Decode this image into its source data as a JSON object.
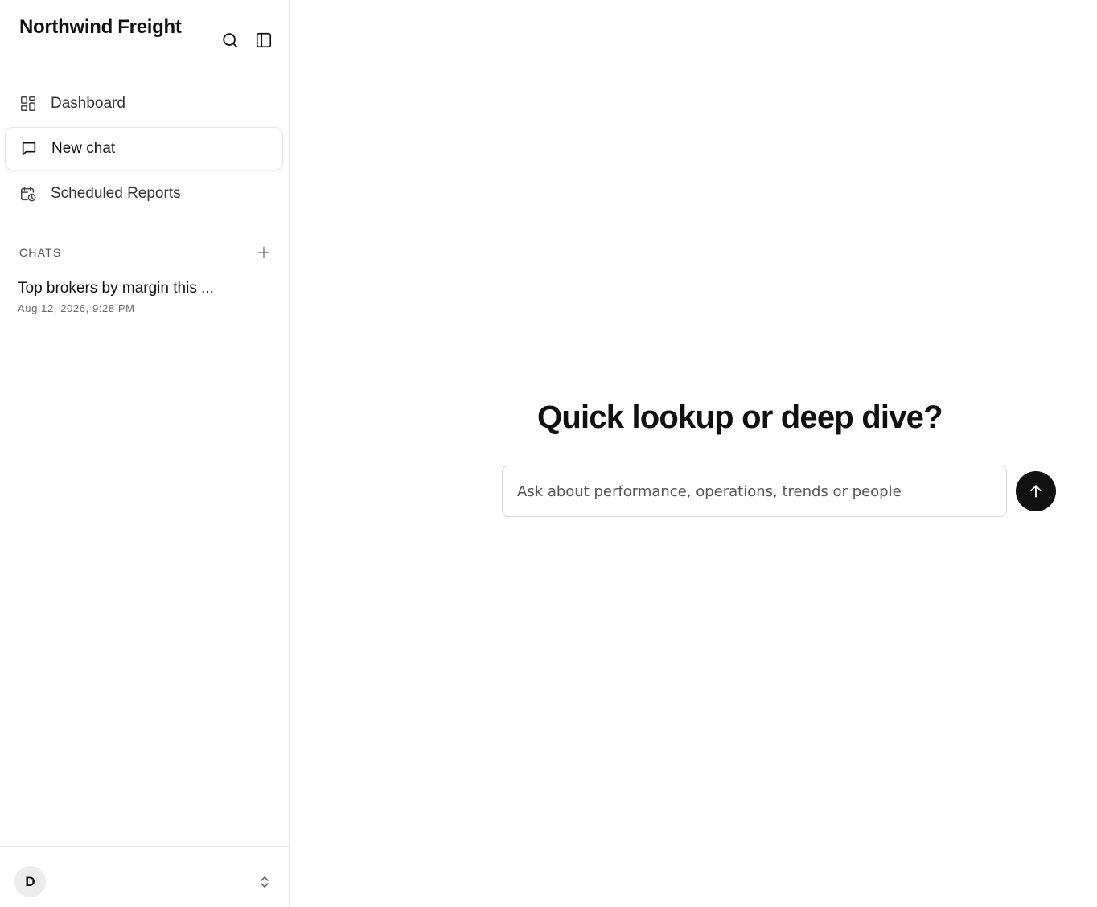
{
  "brand": {
    "name": "Northwind Freight"
  },
  "toolbar": {
    "search_icon": "search-icon",
    "sidebar_toggle_icon": "panel-left-icon"
  },
  "nav": {
    "items": [
      {
        "label": "Dashboard",
        "icon": "dashboard-grid-icon",
        "active": false
      },
      {
        "label": "New chat",
        "icon": "chat-bubble-icon",
        "active": true
      },
      {
        "label": "Scheduled Reports",
        "icon": "calendar-clock-icon",
        "active": false
      }
    ]
  },
  "chats": {
    "section_label": "CHATS",
    "add_icon": "plus-icon",
    "items": [
      {
        "title": "Top brokers by margin this ...",
        "date": "Aug 12, 2026, 9:28 PM"
      }
    ]
  },
  "account": {
    "avatar_initial": "D",
    "toggle_icon": "chevron-up-down-icon"
  },
  "main": {
    "headline": "Quick lookup or deep dive?",
    "prompt": {
      "value": "",
      "placeholder": "Ask about performance, operations, trends or people"
    },
    "send_icon": "arrow-up-icon"
  },
  "colors": {
    "accent": "#111111",
    "border": "#e5e5e5",
    "avatar_bg": "#ececec"
  }
}
